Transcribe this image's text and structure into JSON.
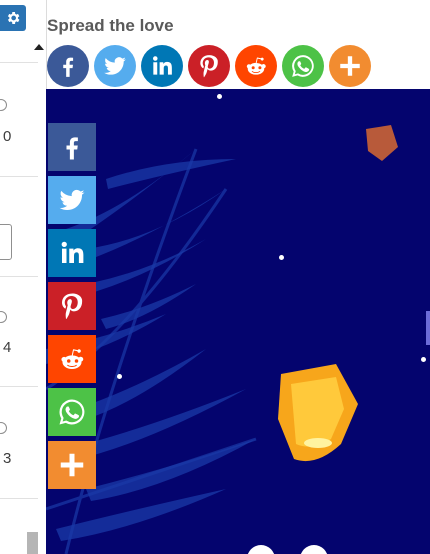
{
  "share": {
    "title": "Spread the love",
    "buttons": [
      {
        "network": "facebook",
        "icon": "facebook-icon",
        "color": "#3b5998"
      },
      {
        "network": "twitter",
        "icon": "twitter-icon",
        "color": "#55acee"
      },
      {
        "network": "linkedin",
        "icon": "linkedin-icon",
        "color": "#0077b5"
      },
      {
        "network": "pinterest",
        "icon": "pinterest-icon",
        "color": "#cb2027"
      },
      {
        "network": "reddit",
        "icon": "reddit-icon",
        "color": "#ff4500"
      },
      {
        "network": "whatsapp",
        "icon": "whatsapp-icon",
        "color": "#4dc247"
      },
      {
        "network": "more",
        "icon": "plus-icon",
        "color": "#f28c30"
      }
    ]
  },
  "left_panel": {
    "accent_color": "#2a73b3",
    "values": [
      "0",
      "4",
      "3"
    ]
  },
  "banner": {
    "background": "#04046e"
  }
}
